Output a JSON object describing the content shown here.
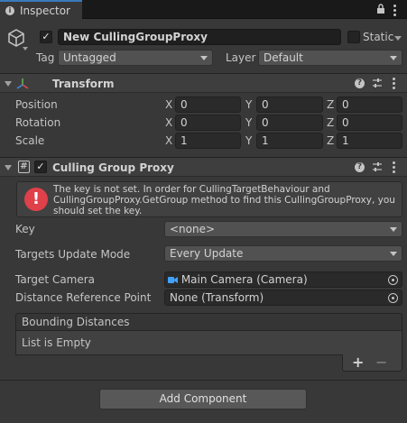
{
  "tab": {
    "title": "Inspector"
  },
  "gameobject": {
    "active": true,
    "name": "New CullingGroupProxy",
    "static_label": "Static",
    "tag_label": "Tag",
    "tag_value": "Untagged",
    "layer_label": "Layer",
    "layer_value": "Default"
  },
  "transform": {
    "title": "Transform",
    "rows": [
      {
        "label": "Position",
        "x": "0",
        "y": "0",
        "z": "0"
      },
      {
        "label": "Rotation",
        "x": "0",
        "y": "0",
        "z": "0"
      },
      {
        "label": "Scale",
        "x": "1",
        "y": "1",
        "z": "1"
      }
    ],
    "axes": {
      "x": "X",
      "y": "Y",
      "z": "Z"
    }
  },
  "culling": {
    "title": "Culling Group Proxy",
    "enabled": true,
    "warning": "The key is not set. In order for CullingTargetBehaviour and CullingGroupProxy.GetGroup method to find this CullingGroupProxy, you should set the key.",
    "key_label": "Key",
    "key_value": "<none>",
    "update_mode_label": "Targets Update Mode",
    "update_mode_value": "Every Update",
    "target_camera_label": "Target Camera",
    "target_camera_value": "Main Camera (Camera)",
    "distance_ref_label": "Distance Reference Point",
    "distance_ref_value": "None (Transform)",
    "bounding_label": "Bounding Distances",
    "list_empty": "List is Empty",
    "add": "+",
    "remove": "−"
  },
  "add_component": "Add Component",
  "icons": {
    "info": "i",
    "help": "?",
    "error": "!",
    "script": "#",
    "check": "✓"
  },
  "colors": {
    "background": "#383838",
    "tab_accent": "#3a79bb",
    "error": "#e0404a",
    "camera_icon": "#3fa2ff"
  }
}
